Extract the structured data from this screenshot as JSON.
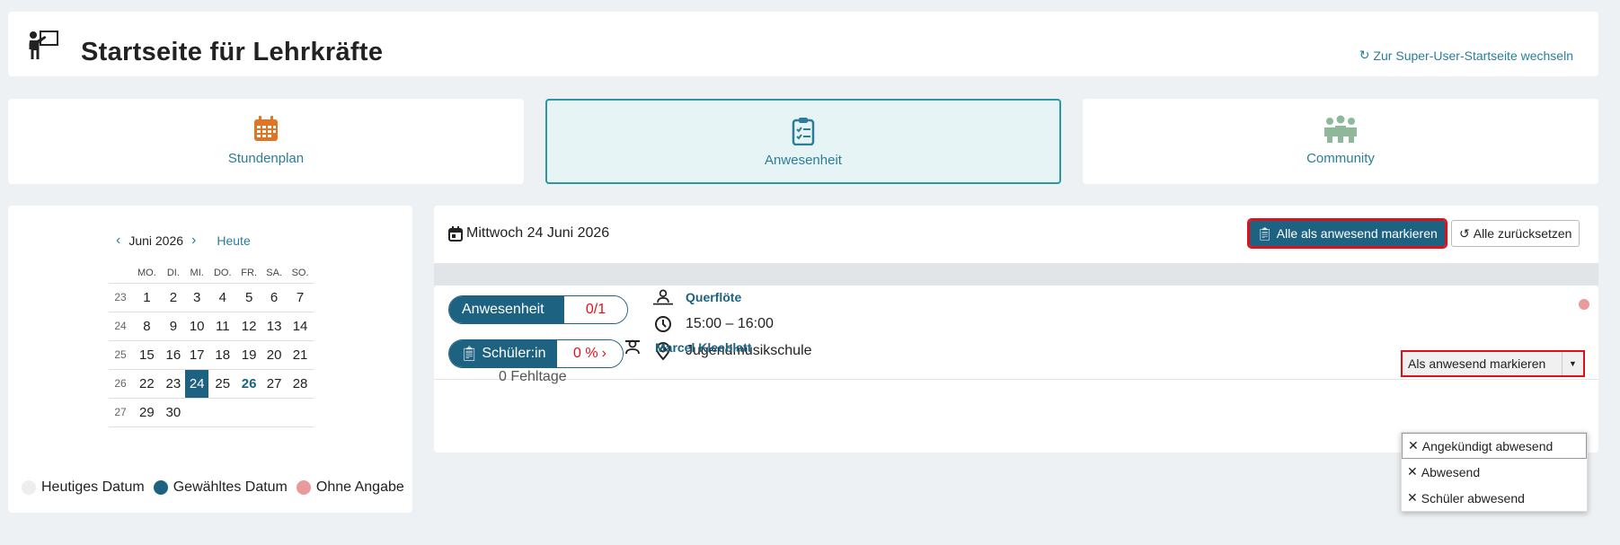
{
  "header": {
    "title": "Startseite für Lehrkräfte",
    "switch_label": "Zur Super-User-Startseite wechseln"
  },
  "tiles": [
    {
      "label": "Stundenplan",
      "icon": "calendar-icon",
      "color": "#e07526",
      "active": false
    },
    {
      "label": "Anwesenheit",
      "icon": "clipboard-check-icon",
      "color": "#2a7e99",
      "active": true
    },
    {
      "label": "Community",
      "icon": "people-icon",
      "color": "#8fb89a",
      "active": false
    }
  ],
  "calendar": {
    "month_label": "Juni 2026",
    "today_label": "Heute",
    "weekdays": [
      "MO.",
      "DI.",
      "MI.",
      "DO.",
      "FR.",
      "SA.",
      "SO."
    ],
    "weeks": [
      {
        "wk": "23",
        "days": [
          "1",
          "2",
          "3",
          "4",
          "5",
          "6",
          "7"
        ]
      },
      {
        "wk": "24",
        "days": [
          "8",
          "9",
          "10",
          "11",
          "12",
          "13",
          "14"
        ]
      },
      {
        "wk": "25",
        "days": [
          "15",
          "16",
          "17",
          "18",
          "19",
          "20",
          "21"
        ]
      },
      {
        "wk": "26",
        "days": [
          "22",
          "23",
          "24",
          "25",
          "26",
          "27",
          "28"
        ]
      },
      {
        "wk": "27",
        "days": [
          "29",
          "30",
          "",
          "",
          "",
          "",
          ""
        ]
      }
    ],
    "selected_day": "24",
    "highlight_day": "26",
    "legend": [
      {
        "label": "Heutiges Datum",
        "color": "#eeeeee"
      },
      {
        "label": "Gewähltes Datum",
        "color": "#1e6281"
      },
      {
        "label": "Ohne Angabe",
        "color": "#e99a9a"
      }
    ]
  },
  "day": {
    "date_label": "Mittwoch 24 Juni 2026",
    "mark_all_label": "Alle als anwesend markieren",
    "reset_all_label": "Alle zurücksetzen"
  },
  "lesson": {
    "attendance_label": "Anwesenheit",
    "attendance_count": "0/1",
    "subject": "Querflöte",
    "time": "15:00 – 16:00",
    "location": "Jugendmusikschule",
    "student_pill_label": "Schüler:in",
    "student_percent": "0 %",
    "absence_days": "0 Fehltage",
    "student_name": "Marcel Kleeblatt",
    "mark_present_label": "Als anwesend markieren",
    "dropdown_options": [
      "Angekündigt abwesend",
      "Abwesend",
      "Schüler abwesend"
    ]
  },
  "colors": {
    "primary": "#1e6281",
    "accent": "#2a7e99",
    "alert": "#e0101a",
    "status_pending": "#e99a9a"
  }
}
